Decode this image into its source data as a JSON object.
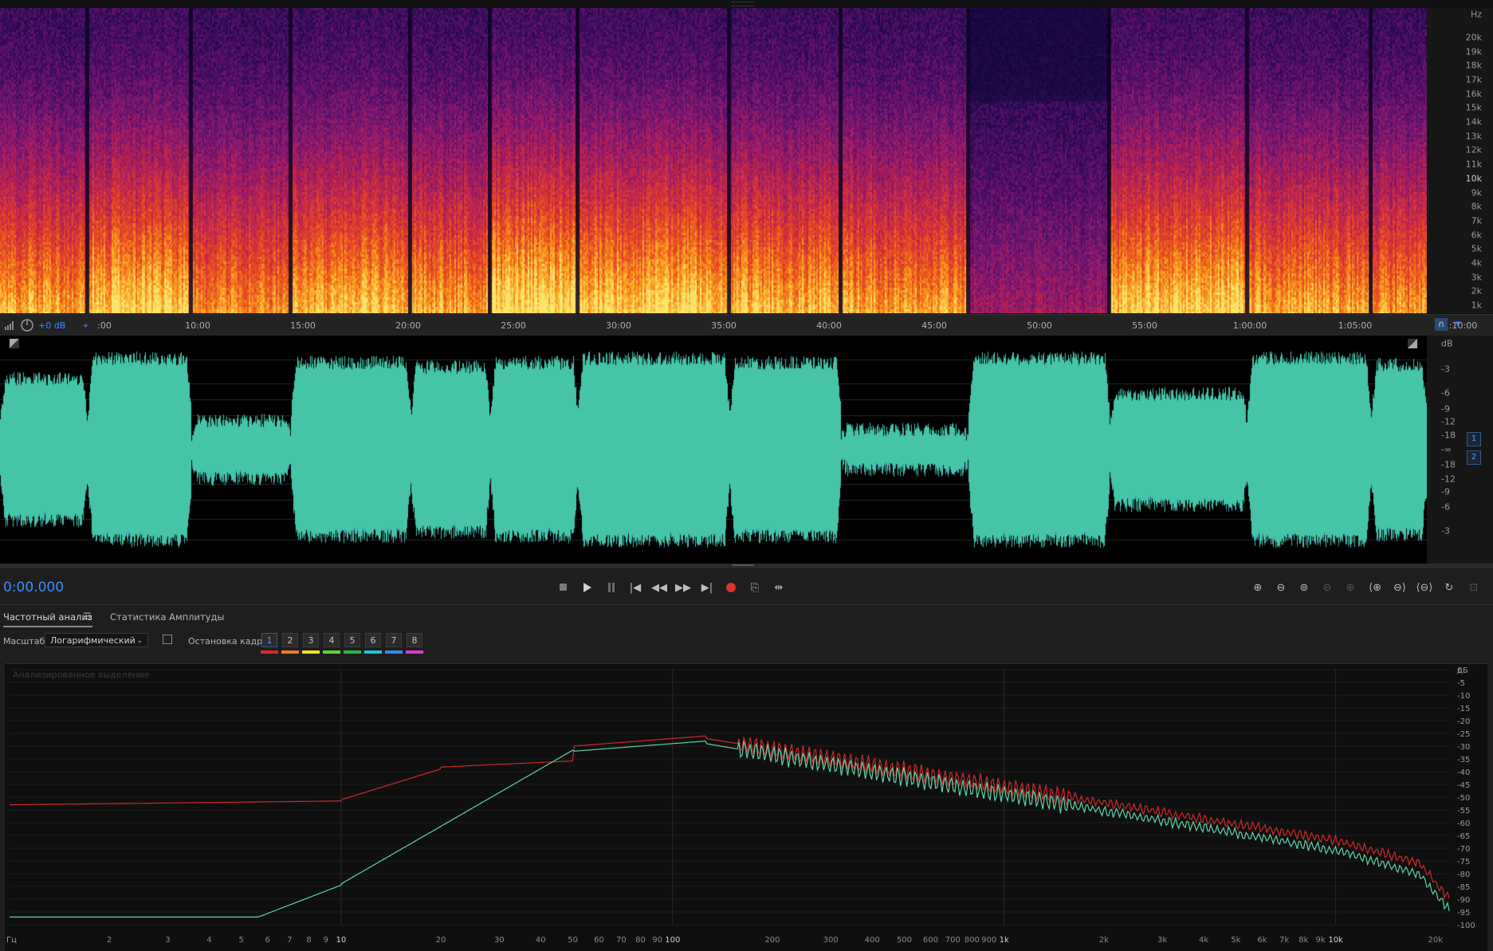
{
  "spectral": {
    "hz_unit": "Hz",
    "hz_labels": [
      "20k",
      "19k",
      "18k",
      "17k",
      "16k",
      "15k",
      "14k",
      "13k",
      "12k",
      "11k",
      "10k",
      "9k",
      "8k",
      "7k",
      "6k",
      "5k",
      "4k",
      "3k",
      "2k",
      "1k"
    ]
  },
  "ruler": {
    "gain": "+0 dB",
    "times": [
      ":00",
      "10:00",
      "15:00",
      "20:00",
      "25:00",
      "30:00",
      "35:00",
      "40:00",
      "45:00",
      "50:00",
      "55:00",
      "1:00:00",
      "1:05:00",
      "1:10:00"
    ]
  },
  "waveform": {
    "db_unit": "dB",
    "db_labels_top": [
      "-3",
      "-6",
      "-9",
      "-12",
      "-18",
      "-∞"
    ],
    "db_labels_bottom": [
      "-18",
      "-12",
      "-9",
      "-6",
      "-3"
    ],
    "channels": [
      "1",
      "2"
    ],
    "fill_color": "#45c4a8"
  },
  "transport": {
    "timecode": "0:00.000",
    "record_color": "#e03030"
  },
  "panel": {
    "tab_frequency": "Частотный анализ",
    "tab_amplitude": "Статистика Амплитуды",
    "menu_icon": "hamburger-icon",
    "scale_label": "Масштаб:",
    "scale_value": "Логарифмический",
    "freeze_label": "Остановка кадра:",
    "frames": [
      "1",
      "2",
      "3",
      "4",
      "5",
      "6",
      "7",
      "8"
    ],
    "frame_colors": [
      "#e0262b",
      "#f07d1f",
      "#f2e224",
      "#5fd43a",
      "#26b84a",
      "#19c9d9",
      "#2f8cf0",
      "#d63ad6"
    ]
  },
  "graph": {
    "caption": "Анализированное выделение",
    "db_unit": "дБ",
    "db_labels": [
      "0",
      "-5",
      "-10",
      "-15",
      "-20",
      "-25",
      "-30",
      "-35",
      "-40",
      "-45",
      "-50",
      "-55",
      "-60",
      "-65",
      "-70",
      "-75",
      "-80",
      "-85",
      "-90",
      "-95",
      "-100"
    ],
    "freq_unit": "Гц",
    "freq_labels": [
      "2",
      "3",
      "4",
      "5",
      "6",
      "7",
      "8",
      "9",
      "10",
      "20",
      "30",
      "40",
      "50",
      "60",
      "70",
      "80",
      "90",
      "100",
      "200",
      "300",
      "400",
      "500",
      "600",
      "700",
      "800",
      "900",
      "1k",
      "2k",
      "3k",
      "4k",
      "5k",
      "6k",
      "7k",
      "8k",
      "9k",
      "10k",
      "20k"
    ],
    "left_color": "#d02828",
    "right_color": "#5fd4a8"
  }
}
